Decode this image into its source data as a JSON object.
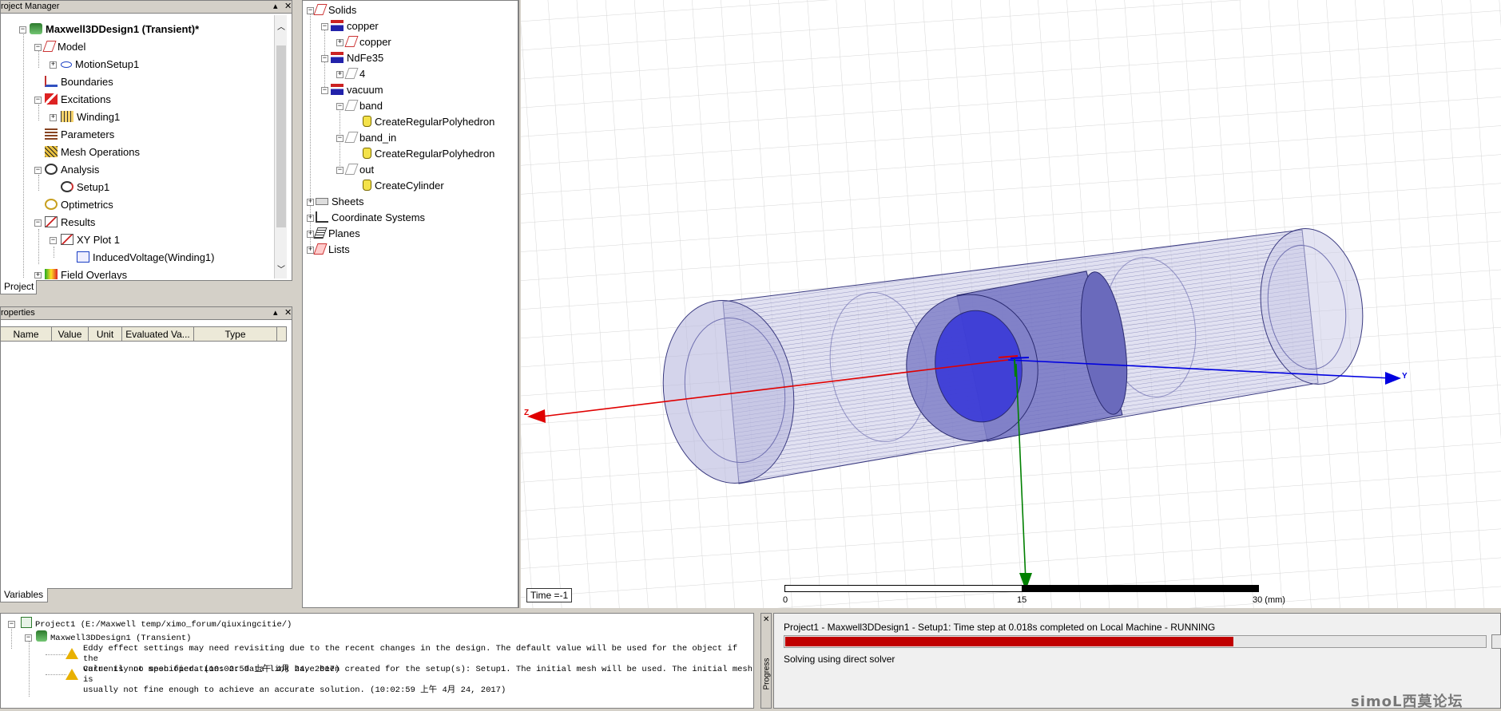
{
  "project_manager": {
    "title": "roject Manager",
    "design": "Maxwell3DDesign1 (Transient)*",
    "items": [
      "Model",
      "MotionSetup1",
      "Boundaries",
      "Excitations",
      "Winding1",
      "Parameters",
      "Mesh Operations",
      "Analysis",
      "Setup1",
      "Optimetrics",
      "Results",
      "XY Plot 1",
      "InducedVoltage(Winding1)",
      "Field Overlays"
    ],
    "tab": "Project"
  },
  "properties": {
    "title": "roperties",
    "columns": [
      "Name",
      "Value",
      "Unit",
      "Evaluated Va...",
      "Type"
    ],
    "tab": "Variables"
  },
  "model_tree": {
    "items": [
      "Solids",
      "copper",
      "copper",
      "NdFe35",
      "4",
      "vacuum",
      "band",
      "CreateRegularPolyhedron",
      "band_in",
      "CreateRegularPolyhedron",
      "out",
      "CreateCylinder",
      "Sheets",
      "Coordinate Systems",
      "Planes",
      "Lists"
    ]
  },
  "viewport": {
    "time_label": "Time =-1",
    "scale": {
      "start": "0",
      "mid": "15",
      "end": "30 (mm)"
    },
    "axes": {
      "x": "Z",
      "y": "Y"
    }
  },
  "messages": {
    "project": "Project1 (E:/Maxwell temp/ximo_forum/qiuxingcitie/)",
    "design": "Maxwell3DDesign1 (Transient)",
    "warn1_l1": "Eddy effect settings may need revisiting due to the recent changes in the design.  The default value will be used for the object if the",
    "warn1_l2": "value is not specified.  (10:02:59 上午  4月 24, 2017)",
    "warn2_l1": "Currently no mesh operations or data link have been created for the setup(s): Setup1.  The initial mesh will be used.  The initial mesh is",
    "warn2_l2": "usually not fine enough to achieve an accurate solution. (10:02:59 上午  4月 24, 2017)"
  },
  "progress": {
    "side_label": "Progress",
    "status": "Project1 - Maxwell3DDesign1 - Setup1: Time step at 0.018s completed on Local Machine - RUNNING",
    "sub_status": "Solving using direct solver",
    "fraction": 0.64,
    "bar_color": "#c00000"
  },
  "watermark": "simoL西莫论坛"
}
